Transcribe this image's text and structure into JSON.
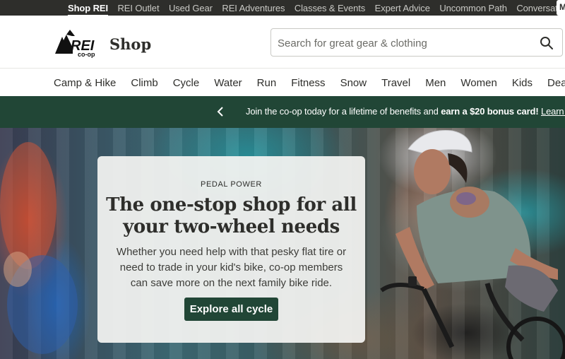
{
  "topbar": {
    "links": [
      {
        "label": "Shop REI",
        "active": true
      },
      {
        "label": "REI Outlet"
      },
      {
        "label": "Used Gear"
      },
      {
        "label": "REI Adventures"
      },
      {
        "label": "Classes & Events"
      },
      {
        "label": "Expert Advice"
      },
      {
        "label": "Uncommon Path"
      },
      {
        "label": "Conversations"
      }
    ],
    "corner_letter": "M"
  },
  "header": {
    "logo_text": "REI",
    "logo_subtext": "co-op",
    "shop_label": "Shop",
    "search": {
      "placeholder": "Search for great gear & clothing",
      "value": "",
      "icon": "search-icon"
    }
  },
  "nav": {
    "items": [
      "Camp & Hike",
      "Climb",
      "Cycle",
      "Water",
      "Run",
      "Fitness",
      "Snow",
      "Travel",
      "Men",
      "Women",
      "Kids",
      "Deals"
    ]
  },
  "promo": {
    "prev_icon": "chevron-left-icon",
    "text": "Join the co-op today for a lifetime of benefits and ",
    "bold_text": "earn a $20 bonus card!",
    "link_text": "Learn ho"
  },
  "hero": {
    "eyebrow": "PEDAL POWER",
    "headline": "The one-stop shop for all your two-wheel needs",
    "body": "Whether you need help with that pesky flat tire or need to trade in your kid's bike, co-op members can save more on the next family bike ride.",
    "cta_label": "Explore all cycle"
  },
  "colors": {
    "topbar_bg": "#2e2e2b",
    "brand_green": "#214636",
    "text_dark": "#2e2e2b"
  }
}
